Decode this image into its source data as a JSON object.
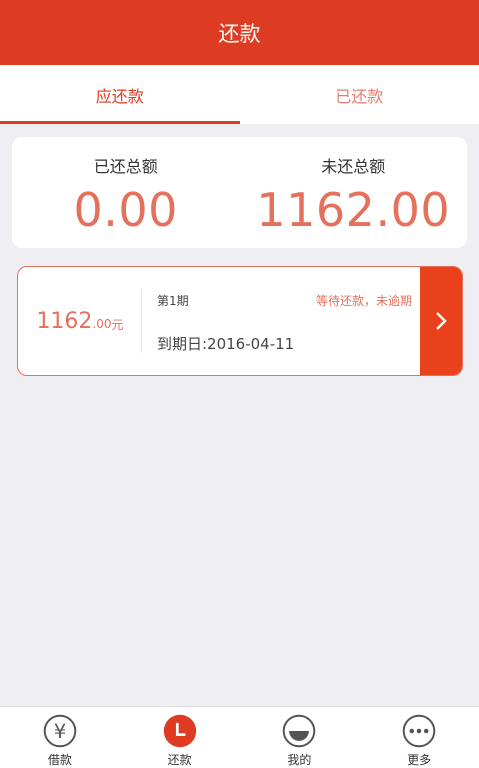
{
  "header": {
    "title": "还款"
  },
  "tabs": [
    {
      "label": "应还款",
      "active": true
    },
    {
      "label": "已还款",
      "active": false
    }
  ],
  "summary": {
    "paid_label": "已还总额",
    "paid_value": "0.00",
    "unpaid_label": "未还总额",
    "unpaid_value": "1162.00"
  },
  "bill": {
    "amount_int": "1162",
    "amount_dec": ".00",
    "currency": "元",
    "period": "第1期",
    "status": "等待还款，未逾期",
    "due": "到期日:2016-04-11"
  },
  "nav": [
    {
      "label": "借款",
      "icon": "yuan-icon"
    },
    {
      "label": "还款",
      "icon": "clock-icon",
      "active": true
    },
    {
      "label": "我的",
      "icon": "smile-icon"
    },
    {
      "label": "更多",
      "icon": "more-icon"
    }
  ],
  "colors": {
    "accent": "#de3c22",
    "accent_light": "#e5705c",
    "arrow_bg": "#e8411c"
  }
}
